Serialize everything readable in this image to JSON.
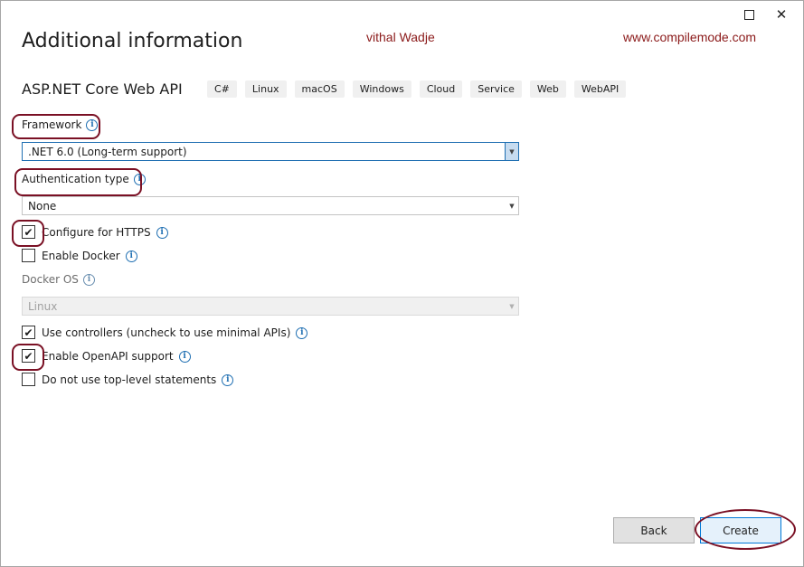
{
  "window": {
    "maximize_icon": "maximize-icon",
    "close_glyph": "✕"
  },
  "page": {
    "title": "Additional information",
    "watermark_author": "vithal Wadje",
    "watermark_site": "www.compilemode.com",
    "project_name": "ASP.NET Core Web API",
    "tags": [
      "C#",
      "Linux",
      "macOS",
      "Windows",
      "Cloud",
      "Service",
      "Web",
      "WebAPI"
    ]
  },
  "form": {
    "framework": {
      "label": "Framework",
      "value": ".NET 6.0 (Long-term support)"
    },
    "auth": {
      "label": "Authentication type",
      "value": "None"
    },
    "https": {
      "label": "Configure for HTTPS",
      "checked": true
    },
    "docker": {
      "label": "Enable Docker",
      "checked": false
    },
    "docker_os": {
      "label": "Docker OS",
      "value": "Linux",
      "enabled": false
    },
    "controllers": {
      "label": "Use controllers (uncheck to use minimal APIs)",
      "checked": true
    },
    "openapi": {
      "label": "Enable OpenAPI support",
      "checked": true
    },
    "toplevel": {
      "label": "Do not use top-level statements",
      "checked": false
    },
    "check_glyph": "✔",
    "info_glyph": "i",
    "dropdown_glyph": "▼"
  },
  "buttons": {
    "back": "Back",
    "create": "Create"
  },
  "colors": {
    "annotation": "#7a1024",
    "watermark": "#8b1a1a",
    "info": "#1f6fb2",
    "accent": "#0078d7"
  }
}
